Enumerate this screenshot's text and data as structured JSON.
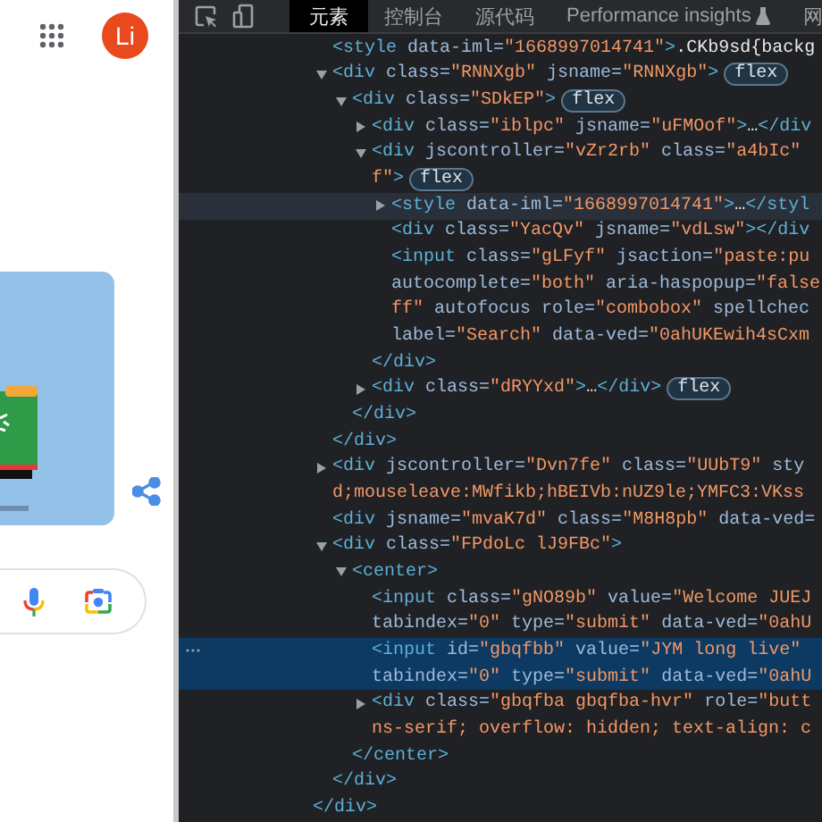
{
  "left_panel": {
    "avatar": {
      "initials": "Li"
    }
  },
  "devtools": {
    "tabs": [
      {
        "label": "元素",
        "selected": true,
        "kind": "plain"
      },
      {
        "label": "控制台",
        "selected": false,
        "kind": "plain"
      },
      {
        "label": "源代码",
        "selected": false,
        "kind": "plain"
      },
      {
        "label": "Performance insights",
        "selected": false,
        "kind": "experimental"
      },
      {
        "label": "网",
        "selected": false,
        "kind": "plain"
      }
    ],
    "tree": {
      "kind": "partial",
      "closing": "</div>",
      "children": [
        {
          "kind": "leaf",
          "selected": false,
          "hovered": false,
          "lines": [
            [
              {
                "kind": "tag",
                "text": "<style"
              },
              {
                "kind": "attr",
                "text": " data-iml="
              },
              {
                "kind": "value",
                "text": "\"1668997014741\""
              },
              {
                "kind": "tag",
                "text": ">"
              },
              {
                "kind": "text",
                "text": ".CKb9sd{backg"
              }
            ]
          ]
        },
        {
          "kind": "branch",
          "expanded": true,
          "selected": false,
          "hovered": false,
          "closing": "</div>",
          "lines": [
            [
              {
                "kind": "tag",
                "text": "<div"
              },
              {
                "kind": "attr",
                "text": " class="
              },
              {
                "kind": "value",
                "text": "\"RNNXgb\""
              },
              {
                "kind": "attr",
                "text": " jsname="
              },
              {
                "kind": "value",
                "text": "\"RNNXgb\""
              },
              {
                "kind": "tag",
                "text": ">"
              },
              {
                "kind": "badge",
                "text": "flex"
              }
            ]
          ],
          "children": [
            {
              "kind": "branch",
              "expanded": true,
              "selected": false,
              "hovered": false,
              "closing": "</div>",
              "lines": [
                [
                  {
                    "kind": "tag",
                    "text": "<div"
                  },
                  {
                    "kind": "attr",
                    "text": " class="
                  },
                  {
                    "kind": "value",
                    "text": "\"SDkEP\""
                  },
                  {
                    "kind": "tag",
                    "text": ">"
                  },
                  {
                    "kind": "badge",
                    "text": "flex"
                  }
                ]
              ],
              "children": [
                {
                  "kind": "branch",
                  "expanded": false,
                  "selected": false,
                  "hovered": false,
                  "lines": [
                    [
                      {
                        "kind": "tag",
                        "text": "<div"
                      },
                      {
                        "kind": "attr",
                        "text": " class="
                      },
                      {
                        "kind": "value",
                        "text": "\"iblpc\""
                      },
                      {
                        "kind": "attr",
                        "text": " jsname="
                      },
                      {
                        "kind": "value",
                        "text": "\"uFMOof\""
                      },
                      {
                        "kind": "tag",
                        "text": ">"
                      },
                      {
                        "kind": "text",
                        "text": "…"
                      },
                      {
                        "kind": "tag",
                        "text": "</div"
                      }
                    ]
                  ]
                },
                {
                  "kind": "branch",
                  "expanded": true,
                  "selected": false,
                  "hovered": false,
                  "closing": "</div>",
                  "lines": [
                    [
                      {
                        "kind": "tag",
                        "text": "<div"
                      },
                      {
                        "kind": "attr",
                        "text": " jscontroller="
                      },
                      {
                        "kind": "value",
                        "text": "\"vZr2rb\""
                      },
                      {
                        "kind": "attr",
                        "text": " class="
                      },
                      {
                        "kind": "value",
                        "text": "\"a4bIc\""
                      }
                    ],
                    [
                      {
                        "kind": "value",
                        "text": "f\""
                      },
                      {
                        "kind": "tag",
                        "text": ">"
                      },
                      {
                        "kind": "badge",
                        "text": "flex"
                      }
                    ]
                  ],
                  "children": [
                    {
                      "kind": "branch",
                      "expanded": false,
                      "selected": false,
                      "hovered": true,
                      "lines": [
                        [
                          {
                            "kind": "tag",
                            "text": "<style"
                          },
                          {
                            "kind": "attr",
                            "text": " data-iml="
                          },
                          {
                            "kind": "value",
                            "text": "\"1668997014741\""
                          },
                          {
                            "kind": "tag",
                            "text": ">"
                          },
                          {
                            "kind": "text",
                            "text": "…"
                          },
                          {
                            "kind": "tag",
                            "text": "</styl"
                          }
                        ]
                      ]
                    },
                    {
                      "kind": "leaf",
                      "selected": false,
                      "hovered": false,
                      "lines": [
                        [
                          {
                            "kind": "tag",
                            "text": "<div"
                          },
                          {
                            "kind": "attr",
                            "text": " class="
                          },
                          {
                            "kind": "value",
                            "text": "\"YacQv\""
                          },
                          {
                            "kind": "attr",
                            "text": " jsname="
                          },
                          {
                            "kind": "value",
                            "text": "\"vdLsw\""
                          },
                          {
                            "kind": "tag",
                            "text": "></div"
                          }
                        ]
                      ]
                    },
                    {
                      "kind": "leaf",
                      "selected": false,
                      "hovered": false,
                      "lines": [
                        [
                          {
                            "kind": "tag",
                            "text": "<input"
                          },
                          {
                            "kind": "attr",
                            "text": " class="
                          },
                          {
                            "kind": "value",
                            "text": "\"gLFyf\""
                          },
                          {
                            "kind": "attr",
                            "text": " jsaction="
                          },
                          {
                            "kind": "value",
                            "text": "\"paste:pu"
                          }
                        ],
                        [
                          {
                            "kind": "attr",
                            "text": "autocomplete="
                          },
                          {
                            "kind": "value",
                            "text": "\"both\""
                          },
                          {
                            "kind": "attr",
                            "text": " aria-haspopup="
                          },
                          {
                            "kind": "value",
                            "text": "\"false"
                          }
                        ],
                        [
                          {
                            "kind": "value",
                            "text": "ff\""
                          },
                          {
                            "kind": "attr",
                            "text": " autofocus role="
                          },
                          {
                            "kind": "value",
                            "text": "\"combobox\""
                          },
                          {
                            "kind": "attr",
                            "text": " spellchec"
                          }
                        ],
                        [
                          {
                            "kind": "attr",
                            "text": "label="
                          },
                          {
                            "kind": "value",
                            "text": "\"Search\""
                          },
                          {
                            "kind": "attr",
                            "text": " data-ved="
                          },
                          {
                            "kind": "value",
                            "text": "\"0ahUKEwih4sCxm"
                          }
                        ]
                      ]
                    }
                  ]
                },
                {
                  "kind": "branch",
                  "expanded": false,
                  "selected": false,
                  "hovered": false,
                  "lines": [
                    [
                      {
                        "kind": "tag",
                        "text": "<div"
                      },
                      {
                        "kind": "attr",
                        "text": " class="
                      },
                      {
                        "kind": "value",
                        "text": "\"dRYYxd\""
                      },
                      {
                        "kind": "tag",
                        "text": ">"
                      },
                      {
                        "kind": "text",
                        "text": "…"
                      },
                      {
                        "kind": "tag",
                        "text": "</div>"
                      },
                      {
                        "kind": "badge",
                        "text": "flex"
                      }
                    ]
                  ]
                }
              ]
            }
          ]
        },
        {
          "kind": "branch",
          "expanded": false,
          "selected": false,
          "hovered": false,
          "lines": [
            [
              {
                "kind": "tag",
                "text": "<div"
              },
              {
                "kind": "attr",
                "text": " jscontroller="
              },
              {
                "kind": "value",
                "text": "\"Dvn7fe\""
              },
              {
                "kind": "attr",
                "text": " class="
              },
              {
                "kind": "value",
                "text": "\"UUbT9\""
              },
              {
                "kind": "attr",
                "text": " sty"
              }
            ],
            [
              {
                "kind": "value",
                "text": "d;mouseleave:MWfikb;hBEIVb:nUZ9le;YMFC3:VKss"
              }
            ]
          ]
        },
        {
          "kind": "leaf",
          "selected": false,
          "hovered": false,
          "lines": [
            [
              {
                "kind": "tag",
                "text": "<div"
              },
              {
                "kind": "attr",
                "text": " jsname="
              },
              {
                "kind": "value",
                "text": "\"mvaK7d\""
              },
              {
                "kind": "attr",
                "text": " class="
              },
              {
                "kind": "value",
                "text": "\"M8H8pb\""
              },
              {
                "kind": "attr",
                "text": " data-ved="
              }
            ]
          ]
        },
        {
          "kind": "branch",
          "expanded": true,
          "selected": false,
          "hovered": false,
          "closing": "</div>",
          "lines": [
            [
              {
                "kind": "tag",
                "text": "<div"
              },
              {
                "kind": "attr",
                "text": " class="
              },
              {
                "kind": "value",
                "text": "\"FPdoLc lJ9FBc\""
              },
              {
                "kind": "tag",
                "text": ">"
              }
            ]
          ],
          "children": [
            {
              "kind": "branch",
              "expanded": true,
              "selected": false,
              "hovered": false,
              "closing": "</center>",
              "lines": [
                [
                  {
                    "kind": "tag",
                    "text": "<center>"
                  }
                ]
              ],
              "children": [
                {
                  "kind": "leaf",
                  "selected": false,
                  "hovered": false,
                  "lines": [
                    [
                      {
                        "kind": "tag",
                        "text": "<input"
                      },
                      {
                        "kind": "attr",
                        "text": " class="
                      },
                      {
                        "kind": "value",
                        "text": "\"gNO89b\""
                      },
                      {
                        "kind": "attr",
                        "text": " value="
                      },
                      {
                        "kind": "value",
                        "text": "\"Welcome JUEJ"
                      }
                    ],
                    [
                      {
                        "kind": "attr",
                        "text": "tabindex="
                      },
                      {
                        "kind": "value",
                        "text": "\"0\""
                      },
                      {
                        "kind": "attr",
                        "text": " type="
                      },
                      {
                        "kind": "value",
                        "text": "\"submit\""
                      },
                      {
                        "kind": "attr",
                        "text": " data-ved="
                      },
                      {
                        "kind": "value",
                        "text": "\"0ahU"
                      }
                    ]
                  ]
                },
                {
                  "kind": "leaf",
                  "selected": true,
                  "hovered": false,
                  "lines": [
                    [
                      {
                        "kind": "tag",
                        "text": "<input"
                      },
                      {
                        "kind": "attr",
                        "text": " id="
                      },
                      {
                        "kind": "value",
                        "text": "\"gbqfbb\""
                      },
                      {
                        "kind": "attr",
                        "text": " value="
                      },
                      {
                        "kind": "value",
                        "text": "\"JYM long live\""
                      }
                    ],
                    [
                      {
                        "kind": "attr",
                        "text": "tabindex="
                      },
                      {
                        "kind": "value",
                        "text": "\"0\""
                      },
                      {
                        "kind": "attr",
                        "text": " type="
                      },
                      {
                        "kind": "value",
                        "text": "\"submit\""
                      },
                      {
                        "kind": "attr",
                        "text": " data-ved="
                      },
                      {
                        "kind": "value",
                        "text": "\"0ahU"
                      }
                    ]
                  ]
                },
                {
                  "kind": "branch",
                  "expanded": false,
                  "selected": false,
                  "hovered": false,
                  "lines": [
                    [
                      {
                        "kind": "tag",
                        "text": "<div"
                      },
                      {
                        "kind": "attr",
                        "text": " class="
                      },
                      {
                        "kind": "value",
                        "text": "\"gbqfba gbqfba-hvr\""
                      },
                      {
                        "kind": "attr",
                        "text": " role="
                      },
                      {
                        "kind": "value",
                        "text": "\"butt"
                      }
                    ],
                    [
                      {
                        "kind": "value",
                        "text": "ns-serif; overflow: hidden; text-align: c"
                      }
                    ]
                  ]
                }
              ]
            }
          ]
        }
      ]
    }
  }
}
